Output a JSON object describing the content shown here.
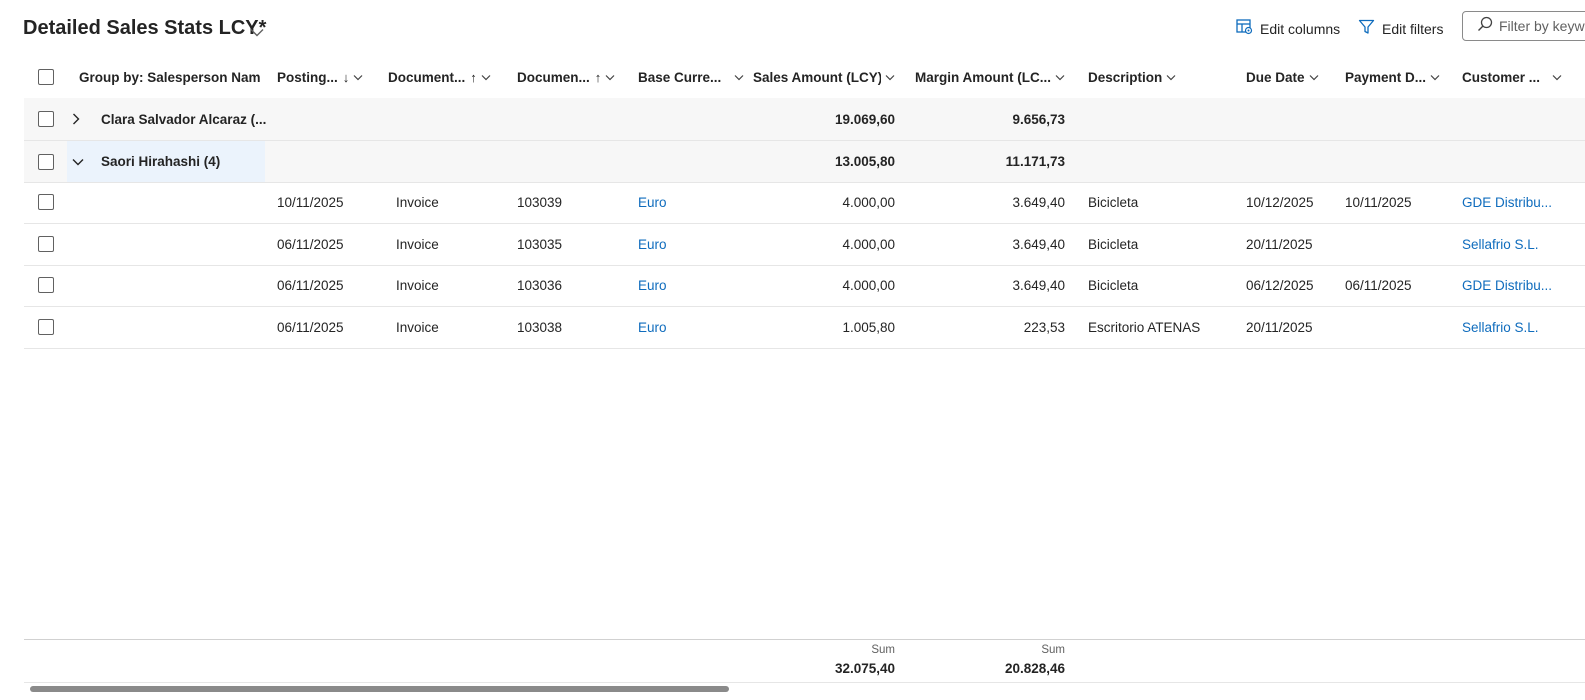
{
  "view": {
    "title": "Detailed Sales Stats LCY*",
    "edit_columns_label": "Edit columns",
    "edit_filters_label": "Edit filters",
    "filter_placeholder": "Filter by keyword"
  },
  "columns": {
    "group_by": "Group by: Salesperson Nam",
    "posting": "Posting...",
    "doc_type": "Document...",
    "doc_no": "Documen...",
    "base_currency": "Base Curre...",
    "sales_amount": "Sales Amount (LCY)",
    "margin_amount": "Margin Amount (LC...",
    "description": "Description",
    "due_date": "Due Date",
    "payment_date": "Payment D...",
    "customer": "Customer ..."
  },
  "sort_indicators": {
    "posting": "↓",
    "doc_type": "↑",
    "doc_no": "↑"
  },
  "groups": [
    {
      "label": "Clara Salvador Alcaraz (...",
      "sales": "19.069,60",
      "margin": "9.656,73",
      "expanded": false
    },
    {
      "label": "Saori Hirahashi (4)",
      "sales": "13.005,80",
      "margin": "11.171,73",
      "expanded": true
    }
  ],
  "rows": [
    {
      "posting": "10/11/2025",
      "doc_type": "Invoice",
      "doc_no": "103039",
      "currency": "Euro",
      "sales": "4.000,00",
      "margin": "3.649,40",
      "description": "Bicicleta",
      "due": "10/12/2025",
      "payment": "10/11/2025",
      "customer": "GDE Distribu..."
    },
    {
      "posting": "06/11/2025",
      "doc_type": "Invoice",
      "doc_no": "103035",
      "currency": "Euro",
      "sales": "4.000,00",
      "margin": "3.649,40",
      "description": "Bicicleta",
      "due": "20/11/2025",
      "payment": "",
      "customer": "Sellafrio S.L."
    },
    {
      "posting": "06/11/2025",
      "doc_type": "Invoice",
      "doc_no": "103036",
      "currency": "Euro",
      "sales": "4.000,00",
      "margin": "3.649,40",
      "description": "Bicicleta",
      "due": "06/12/2025",
      "payment": "06/11/2025",
      "customer": "GDE Distribu..."
    },
    {
      "posting": "06/11/2025",
      "doc_type": "Invoice",
      "doc_no": "103038",
      "currency": "Euro",
      "sales": "1.005,80",
      "margin": "223,53",
      "description": "Escritorio ATENAS",
      "due": "20/11/2025",
      "payment": "",
      "customer": "Sellafrio S.L."
    }
  ],
  "footer": {
    "sales_label": "Sum",
    "sales_total": "32.075,40",
    "margin_label": "Sum",
    "margin_total": "20.828,46"
  },
  "colors": {
    "link": "#0f6cbd",
    "group_highlight": "#ebf3fc"
  }
}
